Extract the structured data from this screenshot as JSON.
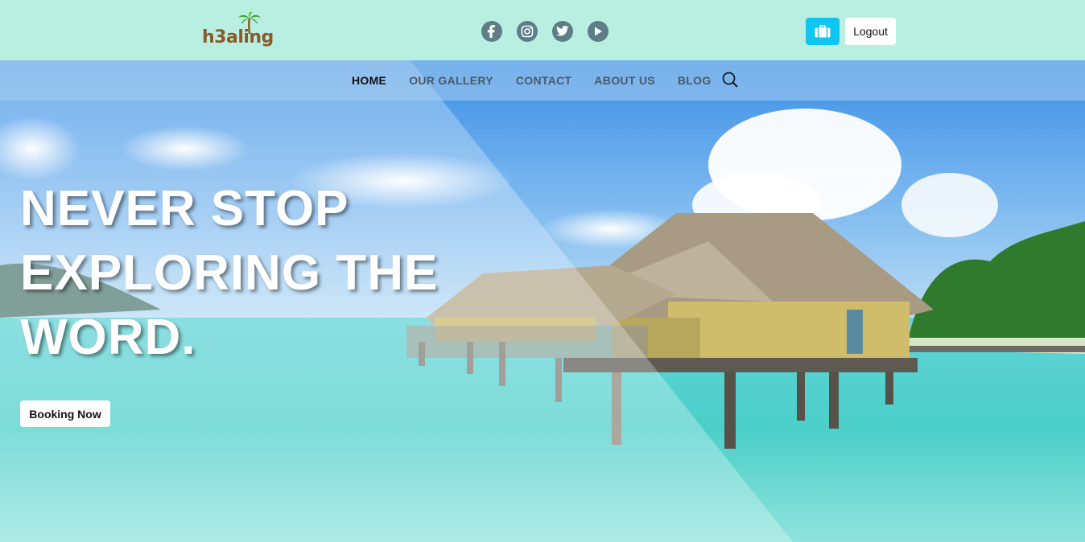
{
  "brand": {
    "logo_text": "h3aling"
  },
  "socials": [
    {
      "name": "facebook-icon"
    },
    {
      "name": "instagram-icon"
    },
    {
      "name": "twitter-icon"
    },
    {
      "name": "youtube-icon"
    }
  ],
  "header": {
    "logout_label": "Logout"
  },
  "nav": {
    "items": [
      {
        "label": "HOME",
        "active": true
      },
      {
        "label": "OUR GALLERY",
        "active": false
      },
      {
        "label": "CONTACT",
        "active": false
      },
      {
        "label": "ABOUT US",
        "active": false
      },
      {
        "label": "BLOG",
        "active": false
      }
    ]
  },
  "hero": {
    "headline_lines": [
      "NEVER STOP",
      "EXPLORING THE",
      "WORD."
    ],
    "cta_label": "Booking Now"
  },
  "colors": {
    "topbar_bg": "#b9efe0",
    "social_icon": "#5d7d87",
    "bag_button": "#0ec6f0",
    "logo_brown": "#8b5a2b"
  }
}
